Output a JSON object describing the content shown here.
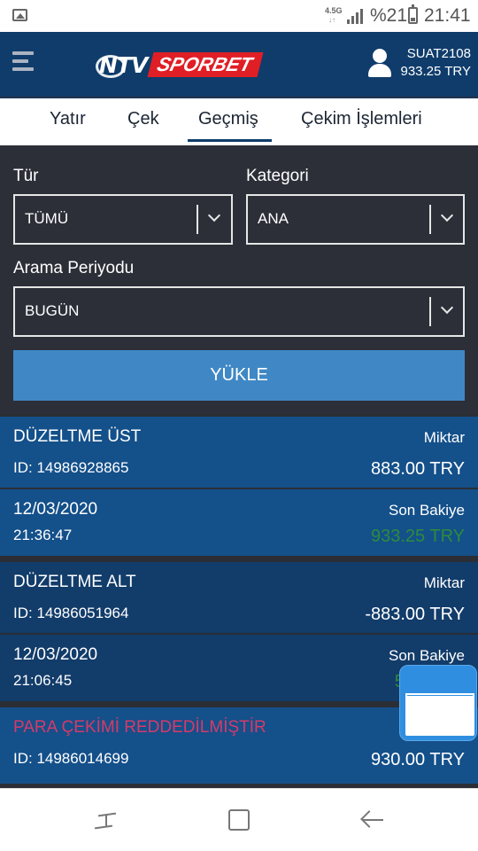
{
  "status_bar": {
    "network": "4.5G",
    "battery_percent": "%21",
    "time": "21:41"
  },
  "header": {
    "logo_ntv": "NTV",
    "logo_sportbet": "SPORBET",
    "username": "SUAT2108",
    "balance": "933.25 TRY"
  },
  "tabs": [
    {
      "label": "Yatır"
    },
    {
      "label": "Çek"
    },
    {
      "label": "Geçmiş",
      "active": true
    },
    {
      "label": "Çekim İşlemleri"
    }
  ],
  "filters": {
    "type_label": "Tür",
    "type_value": "TÜMÜ",
    "category_label": "Kategori",
    "category_value": "ANA",
    "period_label": "Arama Periyodu",
    "period_value": "BUGÜN",
    "load_button": "YÜKLE"
  },
  "transactions": [
    {
      "title": "DÜZELTME ÜST",
      "id": "ID: 14986928865",
      "amount_label": "Miktar",
      "amount": "883.00 TRY",
      "date": "12/03/2020",
      "time": "21:36:47",
      "balance_label": "Son Bakiye",
      "balance": "933.25 TRY"
    },
    {
      "title": "DÜZELTME ALT",
      "id": "ID: 14986051964",
      "amount_label": "Miktar",
      "amount": "-883.00 TRY",
      "date": "12/03/2020",
      "time": "21:06:45",
      "balance_label": "Son Bakiye",
      "balance": "50"
    },
    {
      "title": "PARA ÇEKİMİ REDDEDİLMİŞTİR",
      "id": "ID: 14986014699",
      "amount": "930.00 TRY"
    }
  ],
  "colors": {
    "header_bg": "#0f3c6b",
    "filter_bg": "#2c2f38",
    "button_bg": "#3f88c5",
    "card_light": "#14508a",
    "card_dark": "#123c6a",
    "positive_balance": "#2c8c3c",
    "rejected_text": "#d63a6a",
    "logo_red": "#e01e25"
  }
}
